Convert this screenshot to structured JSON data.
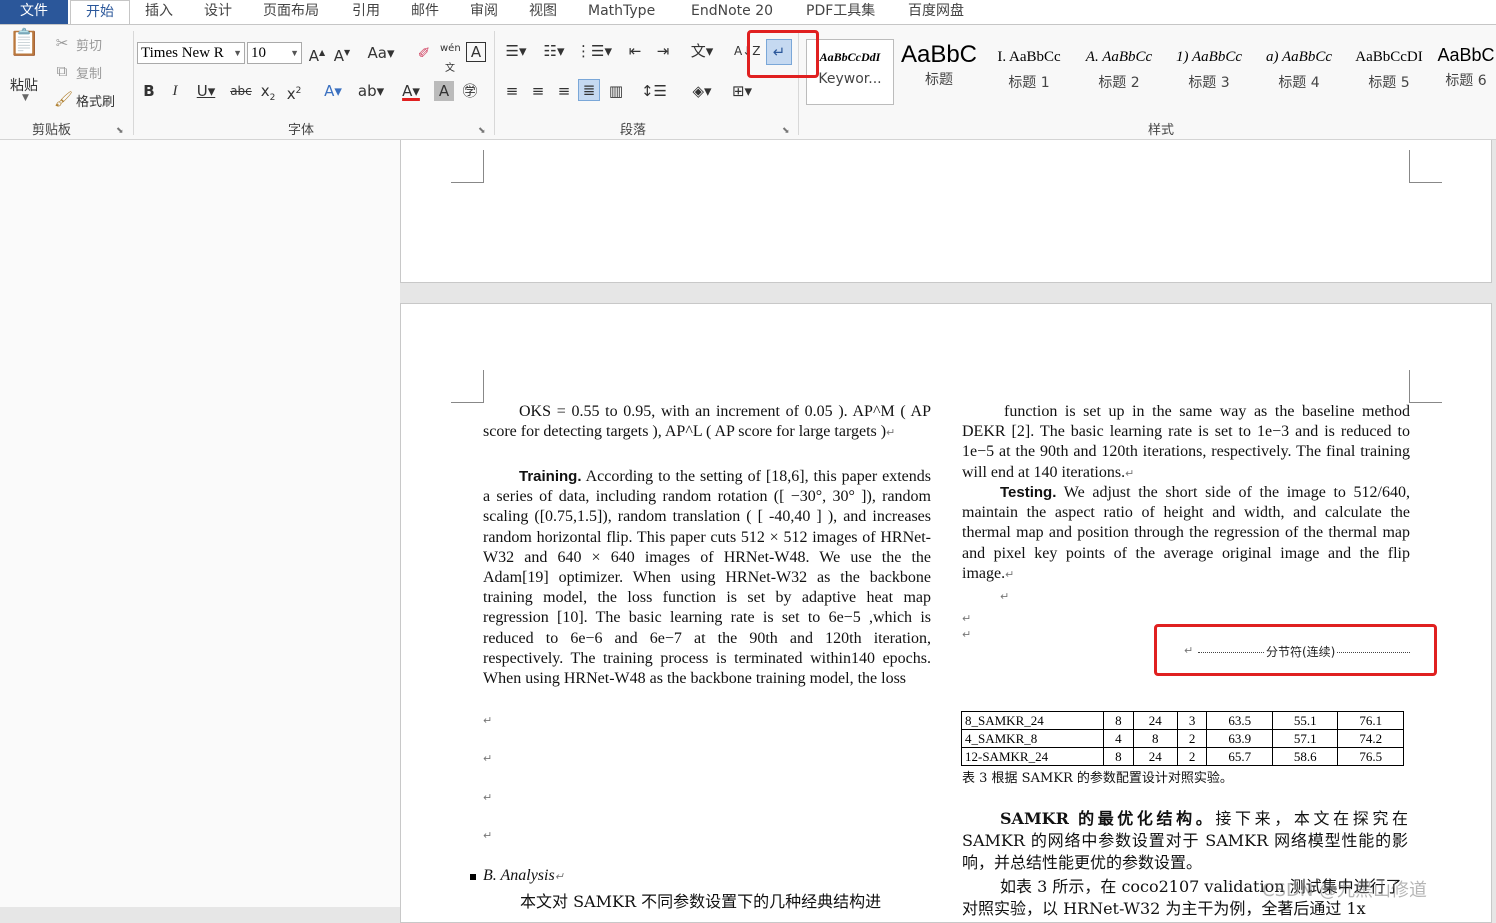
{
  "tabs": [
    "文件",
    "开始",
    "插入",
    "设计",
    "页面布局",
    "引用",
    "邮件",
    "审阅",
    "视图",
    "MathType",
    "EndNote 20",
    "PDF工具集",
    "百度网盘"
  ],
  "ribbon": {
    "clipboard": {
      "paste": "粘贴",
      "cut": "剪切",
      "copy": "复制",
      "format_painter": "格式刷",
      "label": "剪贴板"
    },
    "font": {
      "name": "Times New R",
      "size": "10",
      "label": "字体"
    },
    "paragraph": {
      "label": "段落"
    },
    "styles": {
      "label": "样式",
      "items": [
        {
          "sample": "AaBbCcDdI",
          "name": "Keywor..."
        },
        {
          "sample": "AaBbC",
          "name": "标题"
        },
        {
          "sample": "I. AaBbCc",
          "name": "标题 1"
        },
        {
          "sample": "A. AaBbCc",
          "name": "标题 2"
        },
        {
          "sample": "1) AaBbCc",
          "name": "标题 3"
        },
        {
          "sample": "a) AaBbCc",
          "name": "标题 4"
        },
        {
          "sample": "AaBbCcDI",
          "name": "标题 5"
        },
        {
          "sample": "AaBbC",
          "name": "标题 6"
        }
      ]
    }
  },
  "doc": {
    "left_col": {
      "p1": "OKS = 0.55 to 0.95, with an increment of 0.05 ). AP^M ( AP score for detecting targets ), AP^L ( AP score for large targets )",
      "training_head": "Training.",
      "training_body": "According to the setting of [18,6], this paper extends a series of data, including random rotation ([ −30°, 30° ]), random scaling ([0.75,1.5]), random translation ( [ -40,40 ] ), and increases random horizontal flip. This paper cuts 512 × 512 images of HRNet-W32 and 640 × 640 images of HRNet-W48. We use the the Adam[19] optimizer. When using HRNet-W32 as the backbone training model, the loss function is set by adaptive heat map regression [10]. The basic learning rate is set to 6e−5 ,which is reduced to 6e−6 and 6e−7 at the 90th and 120th iteration, respectively. The training process is terminated within140 epochs. When using HRNet-W48 as the backbone training model, the loss",
      "heading": "B. Analysis",
      "cn_start": "本文对 SAMKR 不同参数设置下的几种经典结构进"
    },
    "right_col": {
      "p1": "function is set up in the same way as the baseline method DEKR [2]. The basic learning rate is set to 1e−3 and is reduced to 1e−5 at the 90th and 120th iterations, respectively. The final training will end at 140 iterations.",
      "testing_head": "Testing.",
      "testing_body": "We adjust the short side of the image to 512/640, maintain the aspect ratio of height and width, and calculate the thermal map and position through the regression of the thermal map and pixel key points of the average original image and the flip image.",
      "section_break": "分节符(连续)",
      "table": [
        [
          "8_SAMKR_24",
          "8",
          "24",
          "3",
          "63.5",
          "55.1",
          "76.1"
        ],
        [
          "4_SAMKR_8",
          "4",
          "8",
          "2",
          "63.9",
          "57.1",
          "74.2"
        ],
        [
          "12-SAMKR_24",
          "8",
          "24",
          "2",
          "65.7",
          "58.6",
          "76.5"
        ]
      ],
      "caption": "表 3 根据 SAMKR 的参数配置设计对照实验。",
      "cn_head": "SAMKR 的最优化结构。",
      "cn_p1": "接下来，本文在探究在 SAMKR 的网络中参数设置对于 SAMKR 网络模型性能的影响，并总结性能更优的参数设置。",
      "cn_p2": "如表 3 所示，在 coco2107 validation 测试集中进行了",
      "cn_p3": "对照实验，以 HRNet-W32 为主干为例，全著后通过 1x"
    }
  },
  "watermark": "CSDN @九黑山修道",
  "colors": {
    "accent": "#2b579a",
    "highlight": "#e02020"
  }
}
